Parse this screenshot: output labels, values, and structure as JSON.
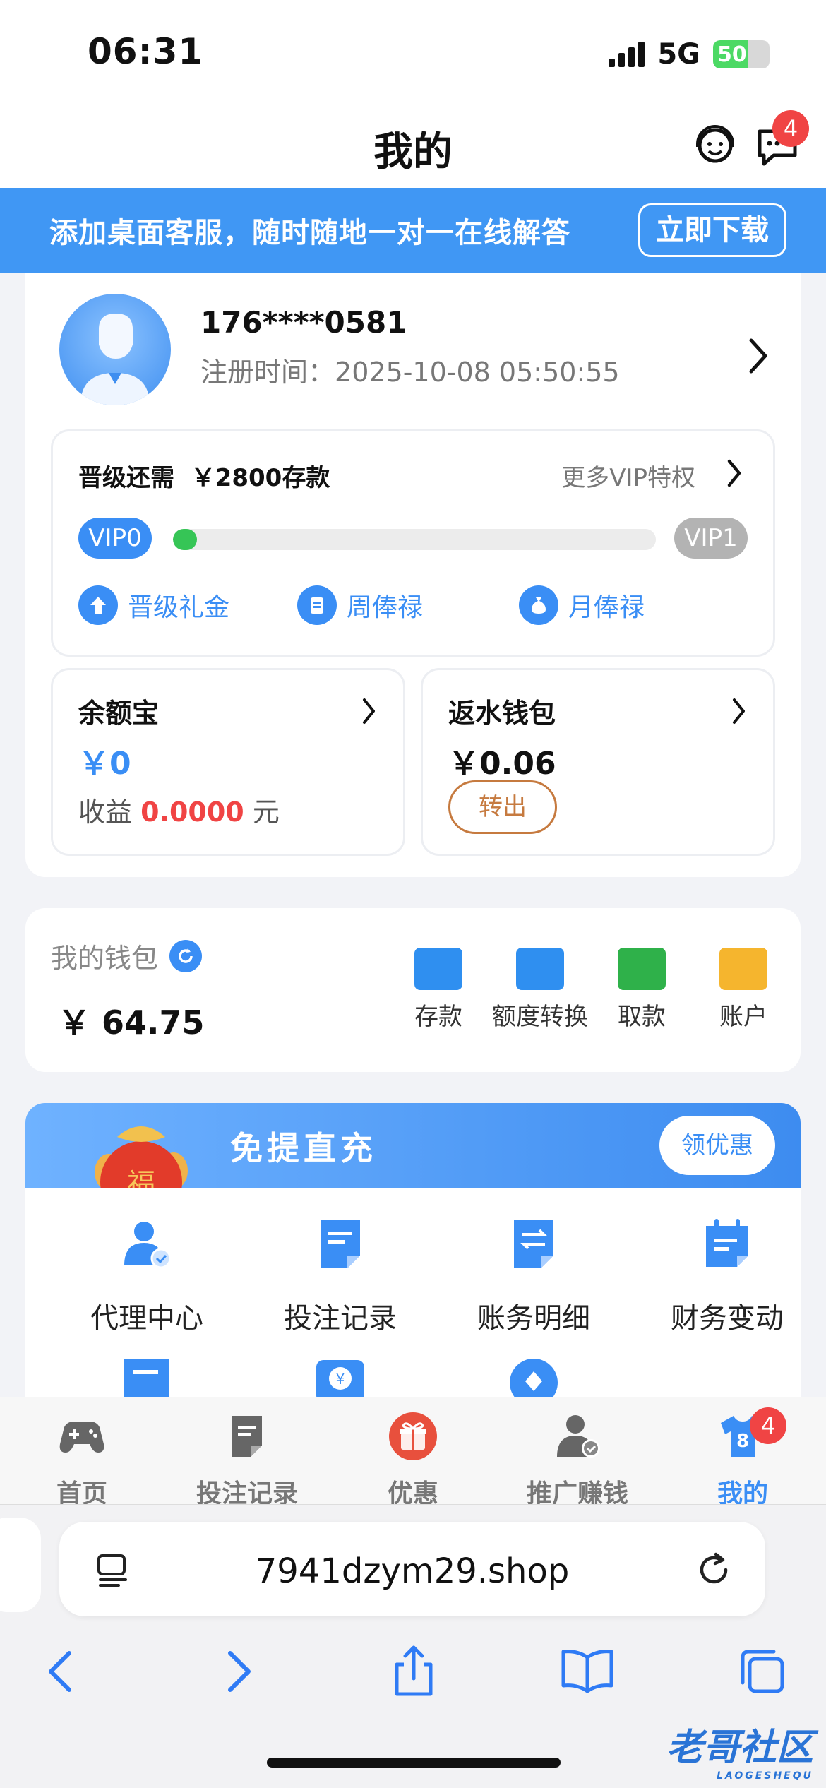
{
  "status": {
    "time": "06:31",
    "network": "5G",
    "battery": "50"
  },
  "header": {
    "title": "我的",
    "message_badge": "4"
  },
  "banner": {
    "text": "添加桌面客服，随时随地一对一在线解答",
    "button": "立即下载"
  },
  "profile": {
    "name": "176****0581",
    "reg_label": "注册时间：",
    "reg_time": "2025-10-08 05:50:55"
  },
  "vip": {
    "need_label": "晋级还需",
    "need_value": "￥2800存款",
    "more": "更多VIP特权",
    "current": "VIP0",
    "next": "VIP1",
    "progress": 0.05,
    "links": [
      "晋级礼金",
      "周俸禄",
      "月俸禄"
    ]
  },
  "balance_treasure": {
    "title": "余额宝",
    "amount": "￥0",
    "income_label": "收益",
    "income_value": "0.0000",
    "income_unit": "元"
  },
  "rebate_wallet": {
    "title": "返水钱包",
    "amount": "￥0.06",
    "button": "转出"
  },
  "wallet": {
    "label": "我的钱包",
    "amount": "￥ 64.75",
    "actions": [
      {
        "label": "存款",
        "icon": "wallet-icon",
        "color": "#2f8ff0"
      },
      {
        "label": "额度转换",
        "icon": "transfer-icon",
        "color": "#2f8ff0"
      },
      {
        "label": "取款",
        "icon": "withdraw-icon",
        "color": "#2fb14a"
      },
      {
        "label": "账户",
        "icon": "card-icon",
        "color": "#f5b52e"
      }
    ]
  },
  "promo": {
    "title": "免提直充",
    "button": "领优惠"
  },
  "grid": [
    "代理中心",
    "投注记录",
    "账务明细",
    "财务变动"
  ],
  "tabbar": {
    "items": [
      "首页",
      "投注记录",
      "优惠",
      "推广赚钱",
      "我的"
    ],
    "active": "我的",
    "badge": "4",
    "shirt_number": "8"
  },
  "browser": {
    "url": "7941dzym29.shop"
  },
  "watermark": {
    "text": "老哥社区",
    "sub": "LAOGESHEQU"
  }
}
